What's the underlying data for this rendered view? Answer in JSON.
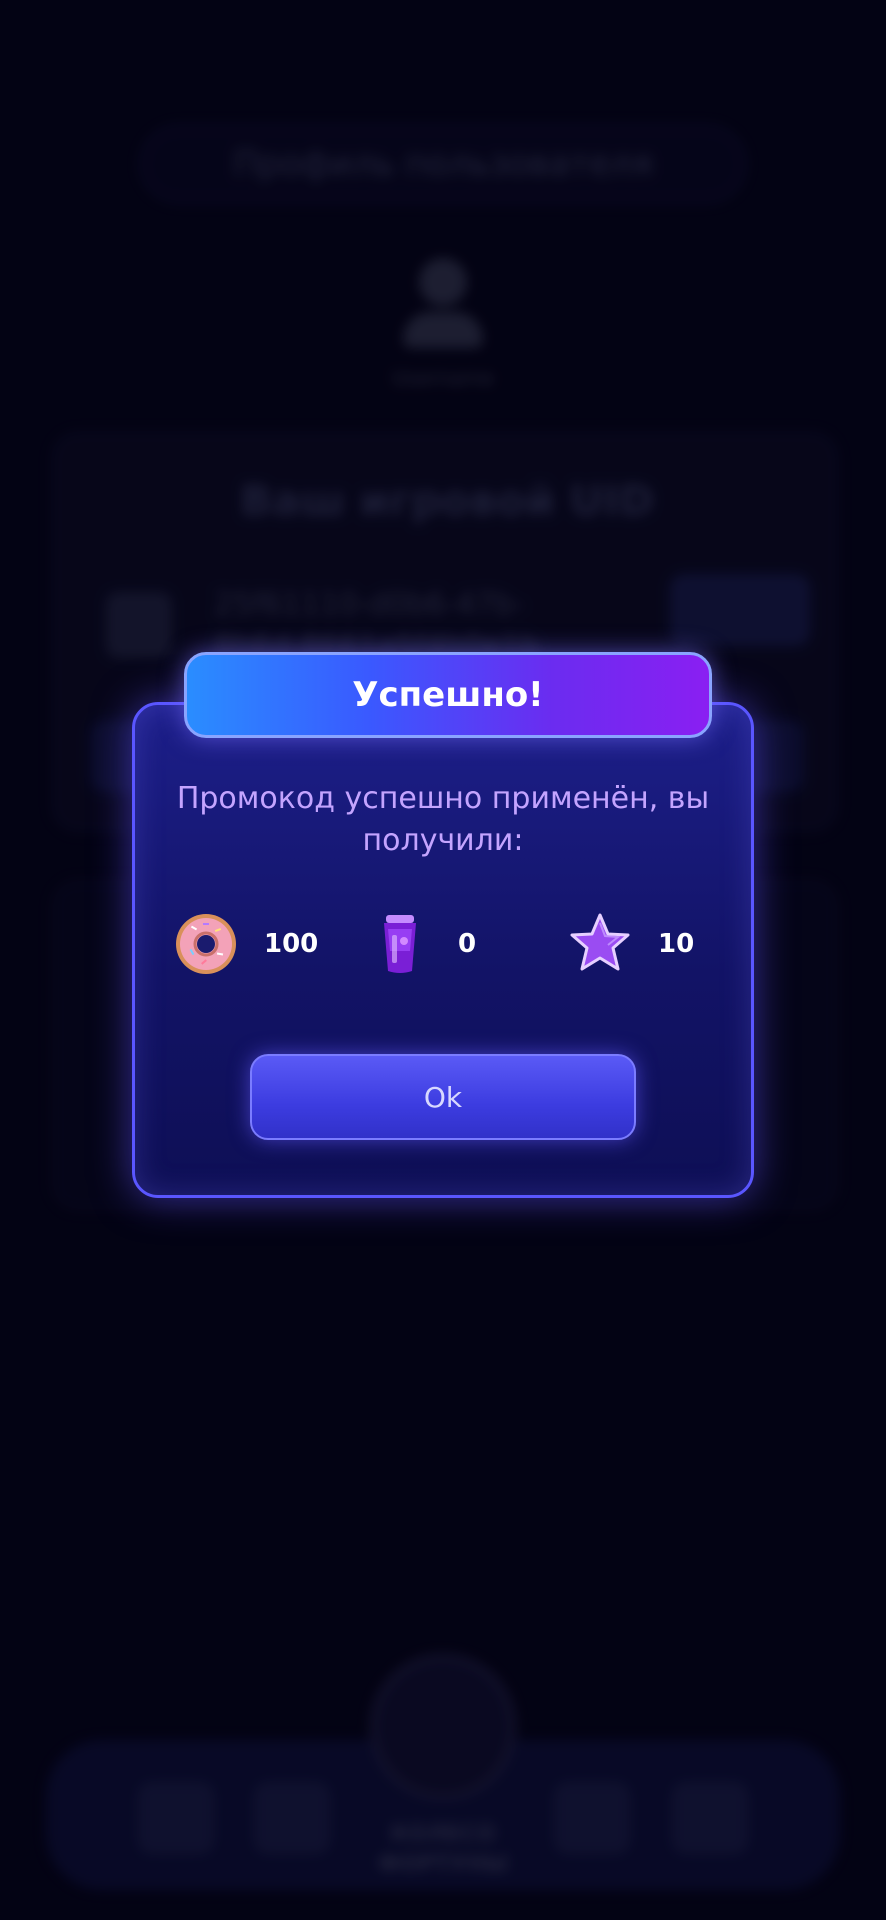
{
  "background": {
    "header_title": "Профиль пользователя",
    "username": "Username",
    "uid_card": {
      "title": "Ваш игровой UID",
      "uid_line1": "25f61110-d0b6-47b-",
      "uid_line2": "8b6d-8661a5f4b0e1b"
    },
    "bottom_nav": {
      "wheel_label_line1": "КОЛЕСО",
      "wheel_label_line2": "ФОРТУНЫ"
    }
  },
  "modal": {
    "title": "Успешно!",
    "message": "Промокод успешно применён, вы получили:",
    "rewards": [
      {
        "icon": "donut-icon",
        "value": "100"
      },
      {
        "icon": "purple-drink-icon",
        "value": "0"
      },
      {
        "icon": "star-icon",
        "value": "10"
      }
    ],
    "ok_label": "Ok"
  },
  "colors": {
    "background": "#050418",
    "modal_border": "#5a56ff",
    "header_gradient_start": "#2a8dff",
    "header_gradient_end": "#8a1ff2",
    "message_text": "#c4a4ff",
    "button": "#3c3ce0"
  }
}
